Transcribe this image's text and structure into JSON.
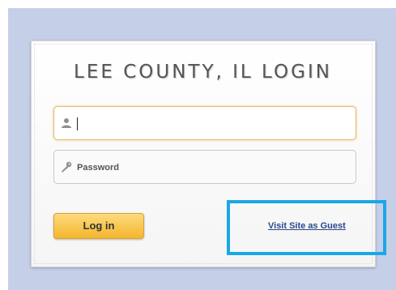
{
  "page": {
    "title": "LEE COUNTY, IL LOGIN"
  },
  "form": {
    "username": {
      "value": "",
      "placeholder": "",
      "icon": "user-icon"
    },
    "password": {
      "value": "",
      "placeholder": "Password",
      "icon": "key-icon"
    },
    "login_label": "Log in",
    "guest_link_label": "Visit Site as Guest"
  },
  "colors": {
    "backdrop": "#c5cfe8",
    "login_button": "#f4b52d",
    "link": "#2b4a8c",
    "highlight": "#1aa7e6"
  }
}
